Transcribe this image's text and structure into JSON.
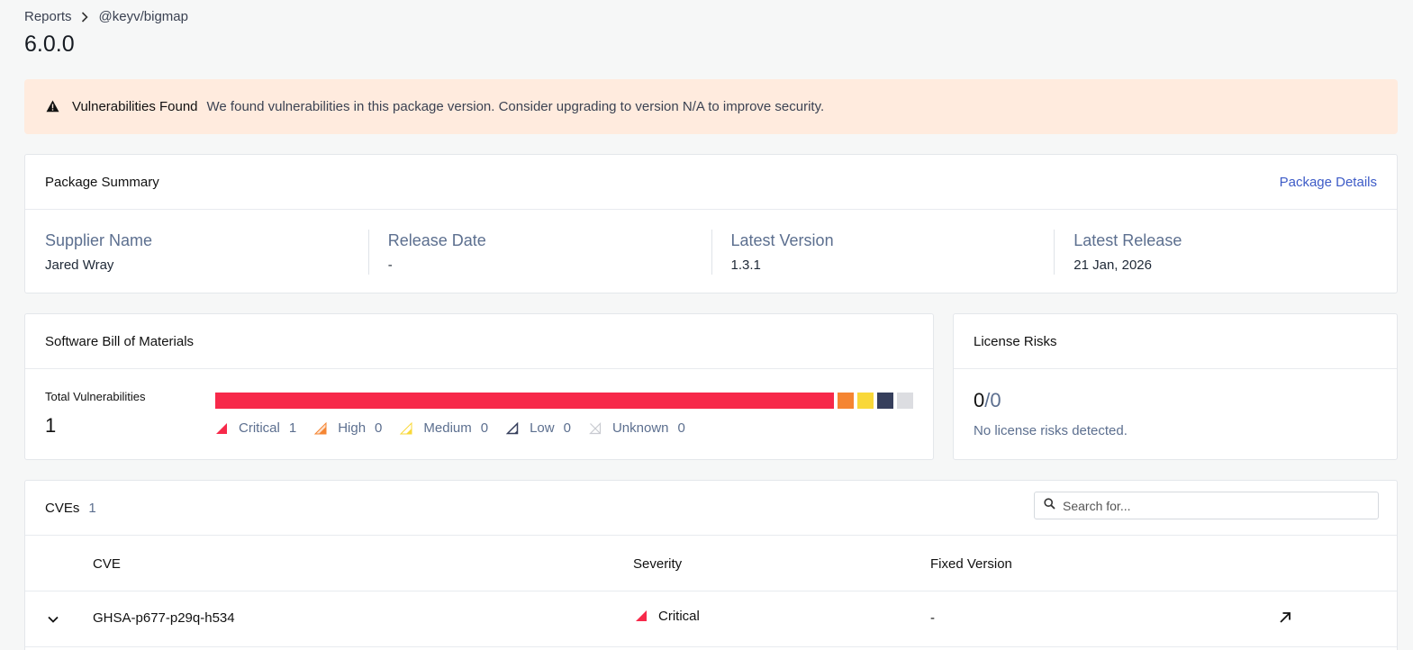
{
  "breadcrumb": {
    "root": "Reports",
    "current": "@keyv/bigmap"
  },
  "page_title": "6.0.0",
  "alert": {
    "title": "Vulnerabilities Found",
    "message": "We found vulnerabilities in this package version. Consider upgrading to version N/A to improve security."
  },
  "summary": {
    "title": "Package Summary",
    "details_link": "Package Details",
    "fields": [
      {
        "label": "Supplier Name",
        "value": "Jared Wray"
      },
      {
        "label": "Release Date",
        "value": "-"
      },
      {
        "label": "Latest Version",
        "value": "1.3.1"
      },
      {
        "label": "Latest Release",
        "value": "21 Jan, 2026"
      }
    ]
  },
  "sbom": {
    "title": "Software Bill of Materials",
    "total_label": "Total Vulnerabilities",
    "total_value": "1",
    "severities": [
      {
        "label": "Critical",
        "count": "1",
        "color": "#f7294a"
      },
      {
        "label": "High",
        "count": "0",
        "color": "#f58532"
      },
      {
        "label": "Medium",
        "count": "0",
        "color": "#f9d839"
      },
      {
        "label": "Low",
        "count": "0",
        "color": "#363f5c"
      },
      {
        "label": "Unknown",
        "count": "0",
        "color": "#dcdde1"
      }
    ]
  },
  "license": {
    "title": "License Risks",
    "count": "0",
    "total": "/0",
    "message": "No license risks detected."
  },
  "cves": {
    "title": "CVEs",
    "count": "1",
    "search_placeholder": "Search for...",
    "columns": {
      "cve": "CVE",
      "severity": "Severity",
      "fixed": "Fixed Version"
    },
    "rows": [
      {
        "id": "GHSA-p677-p29q-h534",
        "severity": "Critical",
        "fixed": "-"
      }
    ]
  }
}
